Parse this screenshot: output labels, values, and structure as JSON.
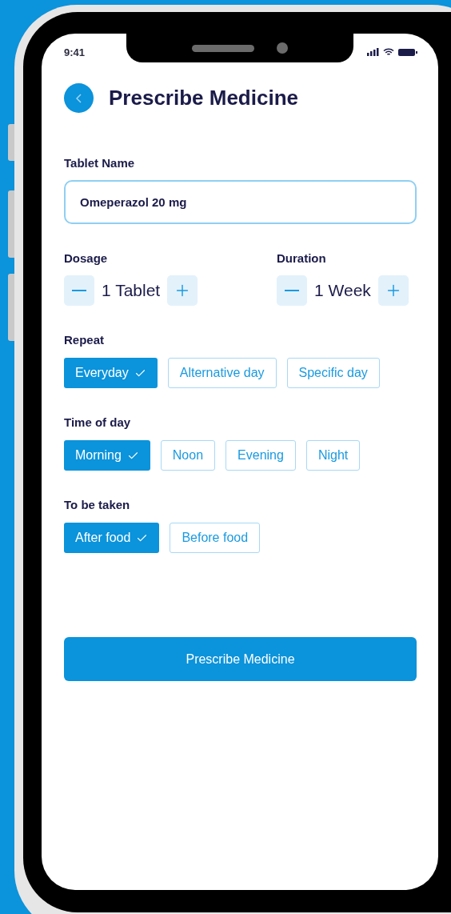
{
  "status_bar": {
    "time": "9:41"
  },
  "header": {
    "title": "Prescribe Medicine"
  },
  "tablet_name": {
    "label": "Tablet Name",
    "value": "Omeperazol 20 mg"
  },
  "steppers": [
    {
      "label": "Dosage",
      "value": "1 Tablet"
    },
    {
      "label": "Duration",
      "value": "1 Week"
    }
  ],
  "groups": [
    {
      "label": "Repeat",
      "options": [
        {
          "label": "Everyday",
          "selected": true
        },
        {
          "label": "Alternative day",
          "selected": false
        },
        {
          "label": "Specific day",
          "selected": false
        }
      ]
    },
    {
      "label": "Time of day",
      "options": [
        {
          "label": "Morning",
          "selected": true
        },
        {
          "label": "Noon",
          "selected": false
        },
        {
          "label": "Evening",
          "selected": false
        },
        {
          "label": "Night",
          "selected": false
        }
      ]
    },
    {
      "label": "To be taken",
      "options": [
        {
          "label": "After food",
          "selected": true
        },
        {
          "label": "Before food",
          "selected": false
        }
      ]
    }
  ],
  "submit_button": "Prescribe Medicine"
}
